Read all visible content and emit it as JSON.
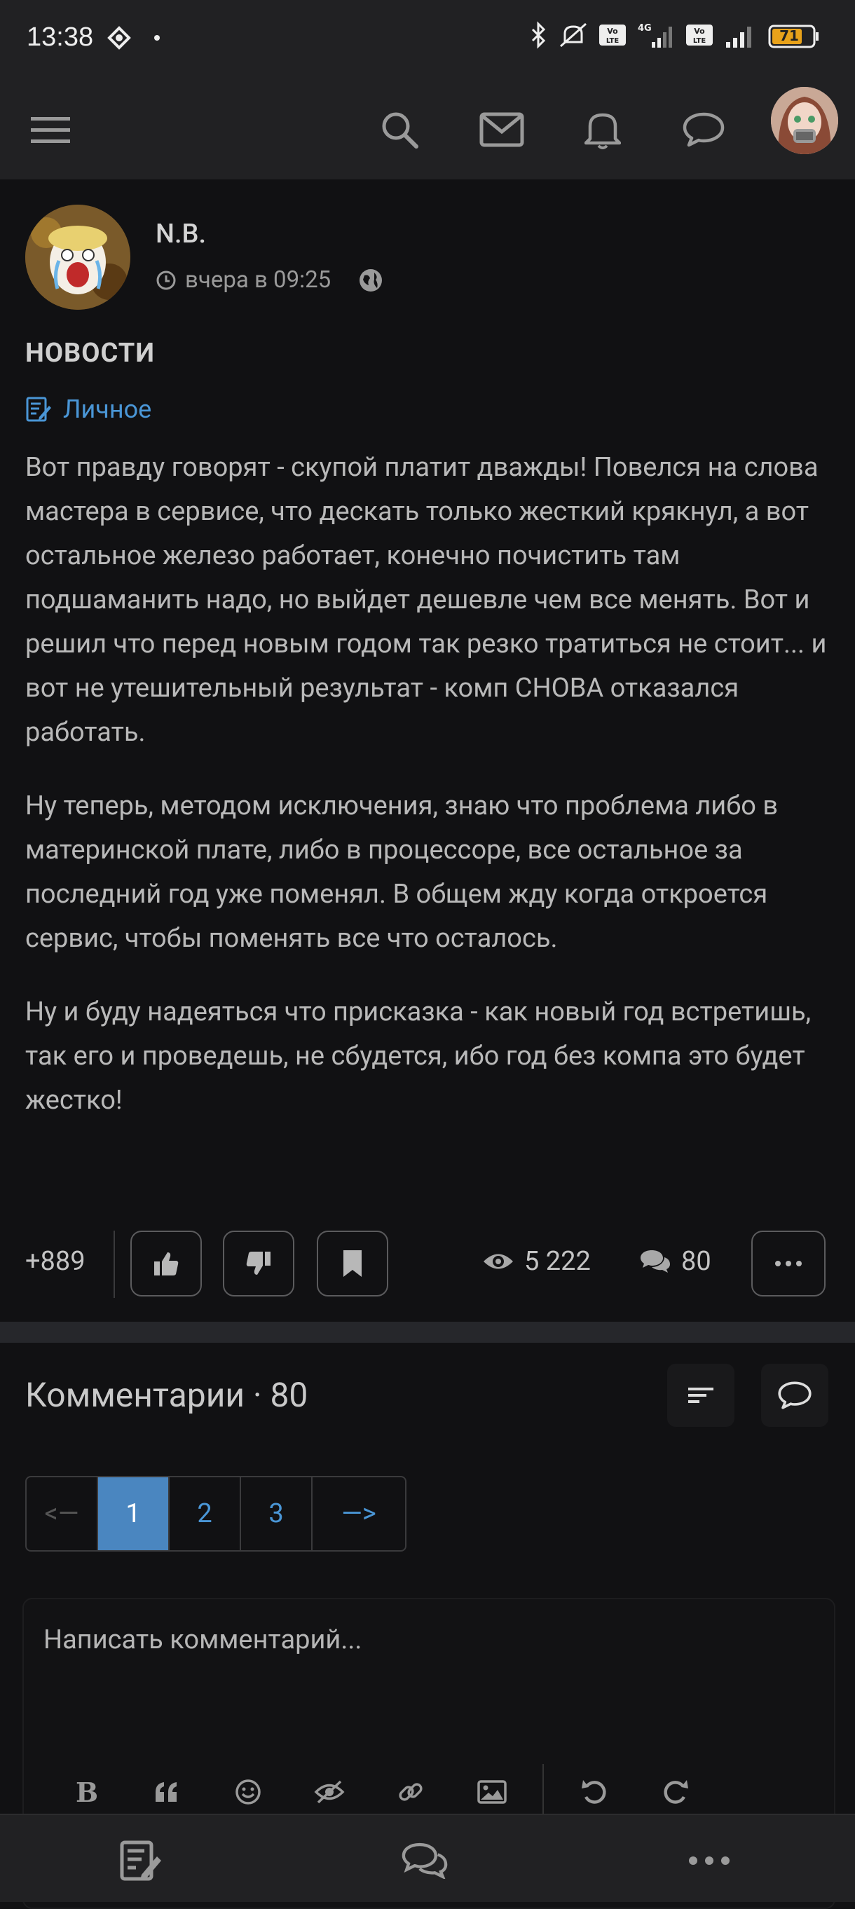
{
  "status_bar": {
    "time": "13:38",
    "battery": "71"
  },
  "post": {
    "author": "N.B.",
    "time": "вчера в 09:25",
    "title": "НОВОСТИ",
    "category": "Личное",
    "paragraphs": [
      "Вот правду говорят - скупой платит дважды! Повелся на слова мастера в сервисе, что дескать только жесткий крякнул, а вот остальное железо работает, конечно почистить там подшаманить надо, но выйдет дешевле чем все менять. Вот и решил что перед новым годом так резко тратиться не стоит... и вот не утешительный результат - комп СНОВА отказался работать.",
      "Ну теперь, методом исключения, знаю что проблема либо в материнской плате, либо в процессоре, все остальное за последний год уже поменял. В общем жду когда откроется сервис, чтобы поменять все что осталось.",
      "Ну и буду надеяться что присказка - как новый год встретишь, так его и проведешь, не сбудется, ибо год без компа это будет жестко!"
    ],
    "rating": "+889",
    "views": "5 222",
    "comments_count": "80"
  },
  "comments": {
    "heading": "Комментарии · 80",
    "pagination": [
      "<—",
      "1",
      "2",
      "3",
      "—>"
    ],
    "editor_placeholder": "Написать комментарий..."
  },
  "colors": {
    "accent": "#4a96d6",
    "background": "#111113",
    "bar": "#212123"
  }
}
